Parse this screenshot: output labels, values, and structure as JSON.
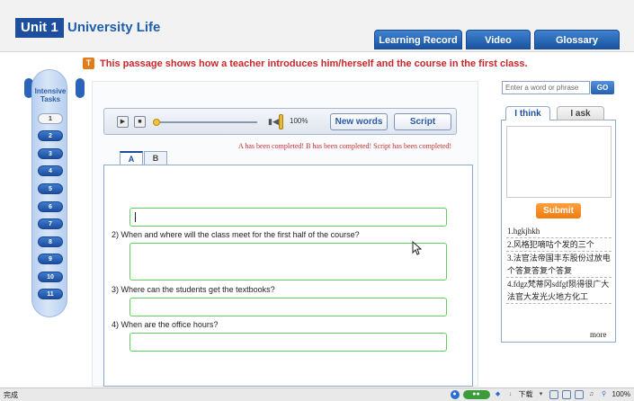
{
  "header": {
    "unit_badge": "Unit 1",
    "unit_title": "University Life",
    "tabs": [
      {
        "label": "Learning Record"
      },
      {
        "label": "Video"
      },
      {
        "label": "Glossary"
      }
    ]
  },
  "notice": {
    "icon": "T",
    "text": "This passage shows how a teacher introduces him/herself and the course in the first class."
  },
  "tasks": {
    "title_line1": "Intensive",
    "title_line2": "Tasks",
    "items": [
      "1",
      "2",
      "3",
      "4",
      "5",
      "6",
      "7",
      "8",
      "9",
      "10",
      "11"
    ],
    "active_index": 0
  },
  "player": {
    "play_icon": "play-icon",
    "stop_icon": "stop-icon",
    "progress": 0.0,
    "volume_percent": "100%",
    "new_words_label": "New words",
    "script_label": "Script"
  },
  "completion_text": "A has been completed!  B has been completed!  Script has been completed!",
  "part_tabs": [
    {
      "label": "A",
      "active": true
    },
    {
      "label": "B",
      "active": false
    }
  ],
  "questions": [
    {
      "text": "2)  When and where will the class meet for the first half of the course?"
    },
    {
      "text": "3)  Where can the students get the textbooks?"
    },
    {
      "text": "4)  When are the office hours?"
    }
  ],
  "search": {
    "placeholder": "Enter a word or phrase",
    "go_label": "GO"
  },
  "right_tabs": [
    {
      "label": "I think",
      "active": true
    },
    {
      "label": "I ask",
      "active": false
    }
  ],
  "submit_label": "Submit",
  "posts": [
    {
      "text": "1.hgkjhkh"
    },
    {
      "text": "2.风格犯嘀咕个发的三个"
    },
    {
      "text": "3.法官法帝国丰东股份过放电个答复答复个答复"
    },
    {
      "text": "4.fdgz梵蒂冈sdfgf陨得很广大法官大发光火地方化工"
    }
  ],
  "more_label": "more",
  "statusbar": {
    "left_text": "完成",
    "download_label": "下载",
    "zoom": "100%"
  }
}
